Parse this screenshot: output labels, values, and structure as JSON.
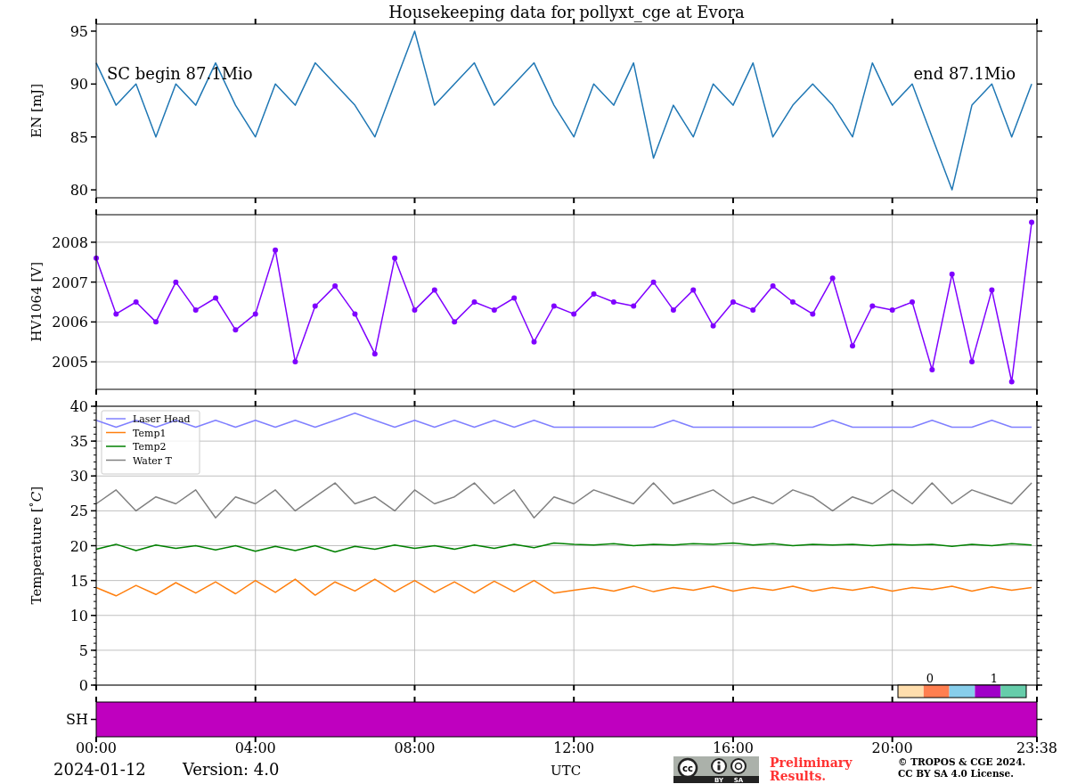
{
  "title": "Housekeeping data for pollyxt_cge at Evora",
  "panels": [
    {
      "chart_data": {
        "type": "line",
        "ylabel": "EN [mJ]",
        "xlim": [
          0,
          23.633
        ],
        "ylim": [
          79.25,
          95.67
        ],
        "yticks": [
          {
            "value": 80,
            "label": "80"
          },
          {
            "value": 85,
            "label": "85"
          },
          {
            "value": 90,
            "label": "90"
          },
          {
            "value": 95,
            "label": "95"
          }
        ],
        "x": [
          0,
          0.5,
          1,
          1.5,
          2,
          2.5,
          3,
          3.5,
          4,
          4.5,
          5,
          5.5,
          6,
          6.5,
          7,
          7.5,
          8,
          8.5,
          9,
          9.5,
          10,
          10.5,
          11,
          11.5,
          12,
          12.5,
          13,
          13.5,
          14,
          14.5,
          15,
          15.5,
          16,
          16.5,
          17,
          17.5,
          18,
          18.5,
          19,
          19.5,
          20,
          20.5,
          21,
          21.5,
          22,
          22.5,
          23,
          23.5
        ],
        "series": [
          {
            "color": "#1f77b4",
            "values": [
              92,
              88,
              90,
              85,
              90,
              88,
              92,
              88,
              85,
              90,
              88,
              92,
              90,
              88,
              85,
              90,
              95,
              88,
              90,
              92,
              88,
              90,
              92,
              88,
              85,
              90,
              88,
              92,
              83,
              88,
              85,
              90,
              88,
              92,
              85,
              88,
              90,
              88,
              85,
              92,
              88,
              90,
              85,
              80,
              88,
              90,
              85,
              90
            ]
          }
        ],
        "annotations": [
          "SC begin 87.1Mio",
          "end 87.1Mio"
        ]
      }
    },
    {
      "chart_data": {
        "type": "line",
        "ylabel": "HV1064 [V]",
        "xlim": [
          0,
          23.633
        ],
        "ylim": [
          2004.31,
          2008.69
        ],
        "grid": true,
        "yticks": [
          {
            "value": 2005,
            "label": "2005"
          },
          {
            "value": 2006,
            "label": "2006"
          },
          {
            "value": 2007,
            "label": "2007"
          },
          {
            "value": 2008,
            "label": "2008"
          }
        ],
        "x": [
          0,
          0.5,
          1,
          1.5,
          2,
          2.5,
          3,
          3.5,
          4,
          4.5,
          5,
          5.5,
          6,
          6.5,
          7,
          7.5,
          8,
          8.5,
          9,
          9.5,
          10,
          10.5,
          11,
          11.5,
          12,
          12.5,
          13,
          13.5,
          14,
          14.5,
          15,
          15.5,
          16,
          16.5,
          17,
          17.5,
          18,
          18.5,
          19,
          19.5,
          20,
          20.5,
          21,
          21.5,
          22,
          22.5,
          23,
          23.5
        ],
        "series": [
          {
            "color": "#7f00ff",
            "marker": "circle",
            "values": [
              2007.6,
              2006.2,
              2006.5,
              2006.0,
              2007.0,
              2006.3,
              2006.6,
              2005.8,
              2006.2,
              2007.8,
              2005.0,
              2006.4,
              2006.9,
              2006.2,
              2005.2,
              2007.6,
              2006.3,
              2006.8,
              2006.0,
              2006.5,
              2006.3,
              2006.6,
              2005.5,
              2006.4,
              2006.2,
              2006.7,
              2006.5,
              2006.4,
              2007.0,
              2006.3,
              2006.8,
              2005.9,
              2006.5,
              2006.3,
              2006.9,
              2006.5,
              2006.2,
              2007.1,
              2005.4,
              2006.4,
              2006.3,
              2006.5,
              2004.8,
              2007.2,
              2005.0,
              2006.8,
              2004.5,
              2008.5
            ]
          }
        ]
      }
    },
    {
      "chart_data": {
        "type": "line",
        "ylabel": "Temperature [$^{∘}$*C*]",
        "xlim": [
          0,
          23.633
        ],
        "ylim": [
          0,
          40
        ],
        "grid": true,
        "legend": "upper left",
        "xticks": [
          {
            "value": 0,
            "label": "00:00"
          },
          {
            "value": 4,
            "label": "04:00"
          },
          {
            "value": 8,
            "label": "08:00"
          },
          {
            "value": 12,
            "label": "12:00"
          },
          {
            "value": 16,
            "label": "16:00"
          },
          {
            "value": 20,
            "label": "20:00"
          },
          {
            "value": 23.633,
            "label": "23:38"
          }
        ],
        "yticks": [
          {
            "value": 0,
            "label": "0"
          },
          {
            "value": 5,
            "label": "5"
          },
          {
            "value": 10,
            "label": "10"
          },
          {
            "value": 15,
            "label": "15"
          },
          {
            "value": 20,
            "label": "20"
          },
          {
            "value": 25,
            "label": "25"
          },
          {
            "value": 30,
            "label": "30"
          },
          {
            "value": 35,
            "label": "35"
          },
          {
            "value": 40,
            "label": "40"
          }
        ],
        "x": [
          0,
          0.5,
          1,
          1.5,
          2,
          2.5,
          3,
          3.5,
          4,
          4.5,
          5,
          5.5,
          6,
          6.5,
          7,
          7.5,
          8,
          8.5,
          9,
          9.5,
          10,
          10.5,
          11,
          11.5,
          12,
          12.5,
          13,
          13.5,
          14,
          14.5,
          15,
          15.5,
          16,
          16.5,
          17,
          17.5,
          18,
          18.5,
          19,
          19.5,
          20,
          20.5,
          21,
          21.5,
          22,
          22.5,
          23,
          23.5
        ],
        "series": [
          {
            "name": "Laser Head",
            "color": "#8080ff",
            "values": [
              38,
              37,
              38,
              37,
              38,
              37,
              38,
              37,
              38,
              37,
              38,
              37,
              38,
              39,
              38,
              37,
              38,
              37,
              38,
              37,
              38,
              37,
              38,
              37,
              37,
              37,
              37,
              37,
              37,
              38,
              37,
              37,
              37,
              37,
              37,
              37,
              37,
              38,
              37,
              37,
              37,
              37,
              38,
              37,
              37,
              38,
              37,
              37
            ]
          },
          {
            "name": "Temp1",
            "color": "#ff7f0e",
            "values": [
              14,
              12.8,
              14.3,
              13,
              14.7,
              13.2,
              14.8,
              13.1,
              15,
              13.3,
              15.2,
              12.9,
              14.8,
              13.5,
              15.2,
              13.4,
              15,
              13.3,
              14.8,
              13.2,
              14.9,
              13.4,
              15,
              13.2,
              13.6,
              14,
              13.5,
              14.2,
              13.4,
              14,
              13.6,
              14.2,
              13.5,
              14,
              13.6,
              14.2,
              13.5,
              14,
              13.6,
              14.1,
              13.5,
              14,
              13.7,
              14.2,
              13.5,
              14.1,
              13.6,
              14
            ]
          },
          {
            "name": "Temp2",
            "color": "#008000",
            "values": [
              19.5,
              20.2,
              19.3,
              20.1,
              19.6,
              20.0,
              19.4,
              20.0,
              19.2,
              19.9,
              19.3,
              20.0,
              19.1,
              19.9,
              19.5,
              20.1,
              19.6,
              20.0,
              19.5,
              20.1,
              19.6,
              20.2,
              19.7,
              20.4,
              20.2,
              20.1,
              20.3,
              20.0,
              20.2,
              20.1,
              20.3,
              20.2,
              20.4,
              20.1,
              20.3,
              20.0,
              20.2,
              20.1,
              20.2,
              20.0,
              20.2,
              20.1,
              20.2,
              19.9,
              20.2,
              20.0,
              20.3,
              20.1
            ]
          },
          {
            "name": "Water T",
            "color": "#808080",
            "values": [
              26,
              28,
              25,
              27,
              26,
              28,
              24,
              27,
              26,
              28,
              25,
              27,
              29,
              26,
              27,
              25,
              28,
              26,
              27,
              29,
              26,
              28,
              24,
              27,
              26,
              28,
              27,
              26,
              29,
              26,
              27,
              28,
              26,
              27,
              26,
              28,
              27,
              25,
              27,
              26,
              28,
              26,
              29,
              26,
              28,
              27,
              26,
              29
            ]
          }
        ]
      }
    }
  ],
  "sh_panel": {
    "ytick": "SH",
    "bars": [
      {
        "color": "#bf00bf"
      }
    ],
    "colorbar": {
      "segments": [
        {
          "color": "#ffdead"
        },
        {
          "color": "#ff7f50"
        },
        {
          "color": "#87ceeb"
        },
        {
          "color": "#a000c8"
        },
        {
          "color": "#66cdaa"
        }
      ],
      "ticks": [
        {
          "label": "0"
        },
        {
          "label": "1"
        }
      ]
    }
  },
  "footer": {
    "date": "2024-01-12",
    "version": "Version: 4.0",
    "xlabel": "UTC",
    "license_badge": {
      "mark": "cc",
      "labels": [
        "BY",
        "SA"
      ]
    },
    "notice": "Preliminary Results.",
    "copyright": [
      "© TROPOS & CGE 2024.",
      "CC BY SA 4.0 License."
    ]
  }
}
